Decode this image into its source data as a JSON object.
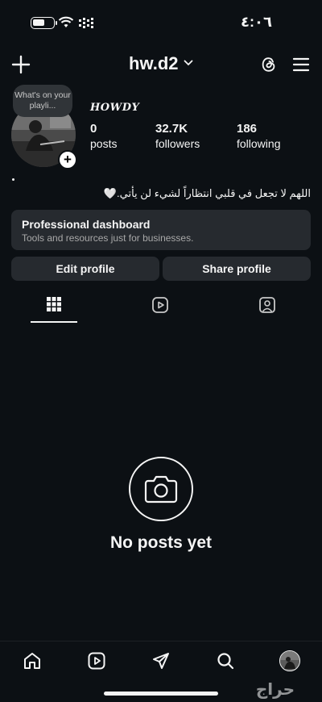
{
  "status_bar": {
    "time": "٤:٠٦"
  },
  "header": {
    "username": "hw.d2"
  },
  "profile": {
    "note": "What's on your playli...",
    "display_name": "HOWDY",
    "stats": [
      {
        "value": "0",
        "label": "posts"
      },
      {
        "value": "32.7K",
        "label": "followers"
      },
      {
        "value": "186",
        "label": "following"
      }
    ],
    "bio": "اللهم لا تجعل في قلبي انتظاراً لشيء لن يأتي.🤍"
  },
  "dashboard": {
    "title": "Professional dashboard",
    "subtitle": "Tools and resources just for businesses."
  },
  "actions": {
    "edit": "Edit profile",
    "share": "Share profile"
  },
  "empty_state": {
    "text": "No posts yet"
  },
  "watermark": "حراج",
  "colors": {
    "background": "#0c1014",
    "button": "#262a2f",
    "text": "#f5f5f5",
    "muted": "#a8a8a8"
  }
}
